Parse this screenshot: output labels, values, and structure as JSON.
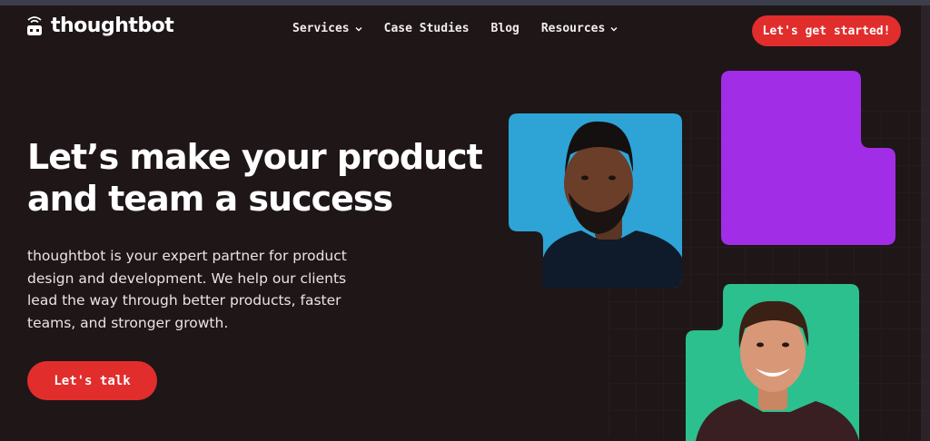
{
  "brand": {
    "name": "thoughtbot",
    "logo_icon": "robot-icon"
  },
  "nav": {
    "items": [
      {
        "label": "Services",
        "has_dropdown": true
      },
      {
        "label": "Case Studies",
        "has_dropdown": false
      },
      {
        "label": "Blog",
        "has_dropdown": false
      },
      {
        "label": "Resources",
        "has_dropdown": true
      }
    ],
    "cta_label": "Let's get started!"
  },
  "hero": {
    "title_line1": "Let’s make your product",
    "title_line2": "and team a success",
    "body_line1": "thoughtbot is your expert partner for product",
    "body_line2": "design and development. We help our clients",
    "body_line3": "lead the way through better products, faster",
    "body_line4": "teams, and stronger growth.",
    "button_label": "Let's talk"
  },
  "colors": {
    "background": "#1f1618",
    "accent_red": "#e22d2d",
    "tile_blue": "#2ea4d6",
    "tile_purple": "#a12ee6",
    "tile_green": "#2cc08e"
  }
}
